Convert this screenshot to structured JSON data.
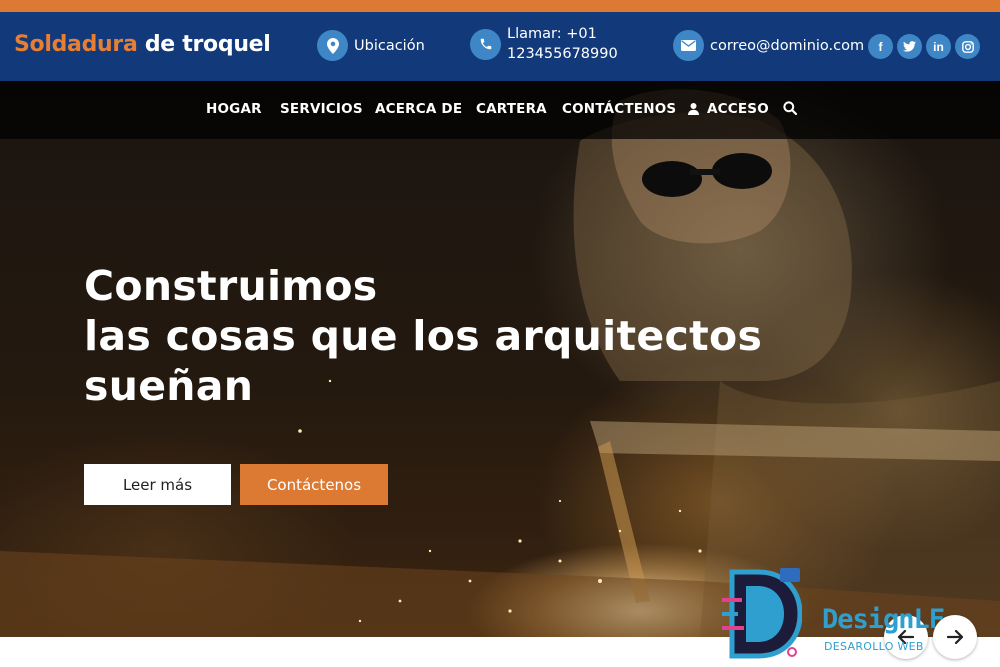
{
  "header": {
    "logo_part1": "Soldadura",
    "logo_part2": "de troquel",
    "location_label": "Ubicación",
    "call_line1": "Llamar: +01",
    "call_line2": "123455678990",
    "email": "correo@dominio.com",
    "socials": [
      {
        "icon": "facebook-icon",
        "glyph": "f"
      },
      {
        "icon": "twitter-icon",
        "glyph": "t"
      },
      {
        "icon": "linkedin-icon",
        "glyph": "in"
      },
      {
        "icon": "instagram-icon",
        "glyph": "◎"
      }
    ]
  },
  "nav": {
    "items": [
      "HOGAR",
      "SERVICIOS",
      "ACERCA DE",
      "CARTERA",
      "CONTÁCTENOS",
      "ACCESO"
    ],
    "search_icon": "search-icon",
    "user_icon": "user-icon"
  },
  "hero": {
    "title_line1": "Construimos",
    "title_line2": "las cosas que los arquitectos",
    "title_line3": "sueñan",
    "btn_read_more": "Leer más",
    "btn_contact": "Contáctenos"
  },
  "watermark": {
    "brand": "DesignLF",
    "subtitle": "DESAROLLO WEB"
  },
  "slider": {
    "prev_icon": "arrow-left-icon",
    "next_icon": "arrow-right-icon"
  },
  "colors": {
    "accent_orange": "#dc7a33",
    "header_blue": "#12397a",
    "icon_blue": "#3f86c6"
  }
}
